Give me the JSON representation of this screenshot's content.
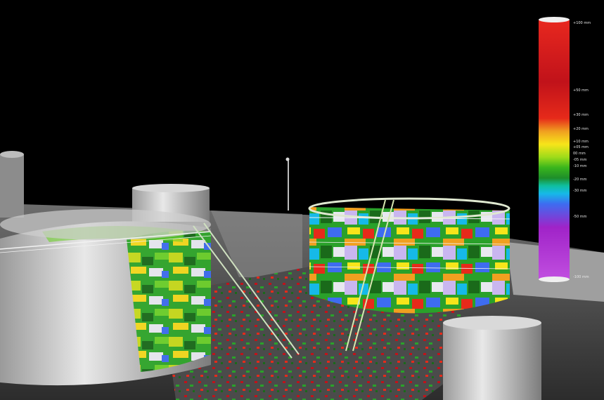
{
  "scene": {
    "background": "#000000",
    "color_scale": {
      "colors": [
        "#e8281f",
        "#c1121a",
        "#e62a1a",
        "#f0a020",
        "#f7e51a",
        "#9ddb1a",
        "#39b51c",
        "#1e8e2a",
        "#0fbfa0",
        "#16b9e8",
        "#3e6cf0",
        "#a023c8",
        "#c14fe0"
      ],
      "labels": [
        "+100 mm",
        "+50 mm",
        "+30 mm",
        "+20 mm",
        "+10 mm",
        "+05 mm",
        "00 mm",
        "-05 mm",
        "-10 mm",
        "-20 mm",
        "-30 mm",
        "-50 mm",
        "-100 mm"
      ]
    }
  }
}
